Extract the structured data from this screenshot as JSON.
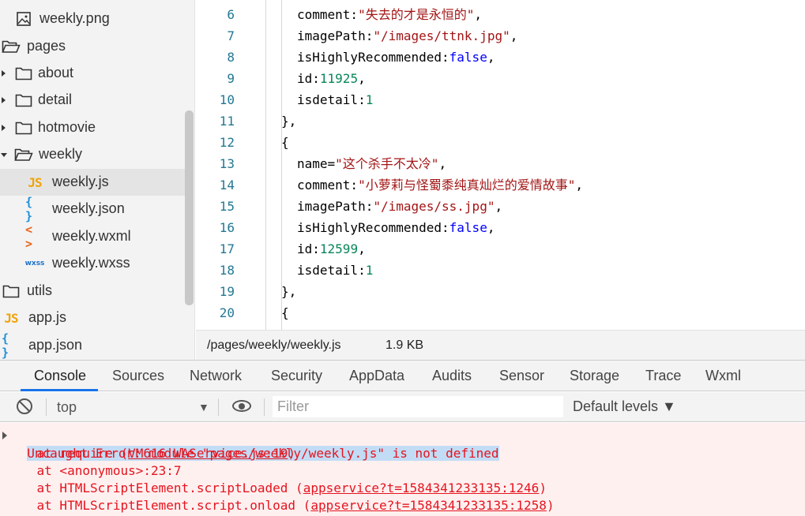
{
  "file_tree": [
    {
      "name": "weekly.png",
      "icon": "image-file-icon"
    },
    {
      "name": "pages",
      "icon": "folder-open-icon"
    },
    {
      "name": "about",
      "icon": "folder-icon"
    },
    {
      "name": "detail",
      "icon": "folder-icon"
    },
    {
      "name": "hotmovie",
      "icon": "folder-icon"
    },
    {
      "name": "weekly",
      "icon": "folder-open-icon"
    },
    {
      "name": "weekly.js",
      "icon": "js-file-icon",
      "icon_text": "JS",
      "selected": true
    },
    {
      "name": "weekly.json",
      "icon": "json-file-icon",
      "icon_text": "{ }"
    },
    {
      "name": "weekly.wxml",
      "icon": "wxml-file-icon",
      "icon_text": "< >"
    },
    {
      "name": "weekly.wxss",
      "icon": "wxss-file-icon",
      "icon_text": "wxss"
    },
    {
      "name": "utils",
      "icon": "folder-icon"
    },
    {
      "name": "app.js",
      "icon": "js-file-icon",
      "icon_text": "JS"
    },
    {
      "name": "app.json",
      "icon": "json-file-icon",
      "icon_text": "{ }"
    }
  ],
  "editor": {
    "lines": [
      {
        "num": "6",
        "parts": [
          [
            "k",
            "comment:"
          ],
          [
            "s",
            "\"失去的才是永恒的\""
          ],
          [
            "k",
            ","
          ]
        ]
      },
      {
        "num": "7",
        "parts": [
          [
            "k",
            "imagePath:"
          ],
          [
            "s",
            "\"/images/ttnk.jpg\""
          ],
          [
            "k",
            ","
          ]
        ]
      },
      {
        "num": "8",
        "parts": [
          [
            "k",
            "isHighlyRecommended:"
          ],
          [
            "b",
            "false"
          ],
          [
            "k",
            ","
          ]
        ]
      },
      {
        "num": "9",
        "parts": [
          [
            "k",
            "id:"
          ],
          [
            "n",
            "11925"
          ],
          [
            "k",
            ","
          ]
        ]
      },
      {
        "num": "10",
        "parts": [
          [
            "k",
            "isdetail:"
          ],
          [
            "n",
            "1"
          ]
        ]
      },
      {
        "num": "11",
        "parts": [
          [
            "k",
            "},"
          ]
        ]
      },
      {
        "num": "12",
        "parts": [
          [
            "k",
            "{"
          ]
        ]
      },
      {
        "num": "13",
        "parts": [
          [
            "k",
            "name="
          ],
          [
            "s",
            "\"这个杀手不太冷\""
          ],
          [
            "k",
            ","
          ]
        ]
      },
      {
        "num": "14",
        "parts": [
          [
            "k",
            "comment:"
          ],
          [
            "s",
            "\"小萝莉与怪蜀黍纯真灿烂的爱情故事\""
          ],
          [
            "k",
            ","
          ]
        ]
      },
      {
        "num": "15",
        "parts": [
          [
            "k",
            "imagePath:"
          ],
          [
            "s",
            "\"/images/ss.jpg\""
          ],
          [
            "k",
            ","
          ]
        ]
      },
      {
        "num": "16",
        "parts": [
          [
            "k",
            "isHighlyRecommended:"
          ],
          [
            "b",
            "false"
          ],
          [
            "k",
            ","
          ]
        ]
      },
      {
        "num": "17",
        "parts": [
          [
            "k",
            "id:"
          ],
          [
            "n",
            "12599"
          ],
          [
            "k",
            ","
          ]
        ]
      },
      {
        "num": "18",
        "parts": [
          [
            "k",
            "isdetail:"
          ],
          [
            "n",
            "1"
          ]
        ]
      },
      {
        "num": "19",
        "parts": [
          [
            "k",
            "},"
          ]
        ]
      },
      {
        "num": "20",
        "parts": [
          [
            "k",
            "{"
          ]
        ]
      }
    ]
  },
  "status_bar": {
    "path": "/pages/weekly/weekly.js",
    "size": "1.9 KB"
  },
  "devtools": {
    "tabs": [
      "Console",
      "Sources",
      "Network",
      "Security",
      "AppData",
      "Audits",
      "Sensor",
      "Storage",
      "Trace",
      "Wxml"
    ],
    "active_tab": "Console",
    "context": "top",
    "filter_placeholder": "Filter",
    "levels": "Default levels ▼"
  },
  "console": {
    "error": "Uncaught Error: module \"pages/weekly/weekly.js\" is not defined",
    "stack": [
      {
        "prefix": "    at require (",
        "link": "VM616 WAService.js:19",
        "suffix": ")"
      },
      {
        "prefix": "    at <anonymous>:23:7",
        "link": "",
        "suffix": ""
      },
      {
        "prefix": "    at HTMLScriptElement.scriptLoaded (",
        "link": "appservice?t=1584341233135:1246",
        "suffix": ")"
      },
      {
        "prefix": "    at HTMLScriptElement.script.onload (",
        "link": "appservice?t=1584341233135:1258",
        "suffix": ")"
      }
    ]
  }
}
